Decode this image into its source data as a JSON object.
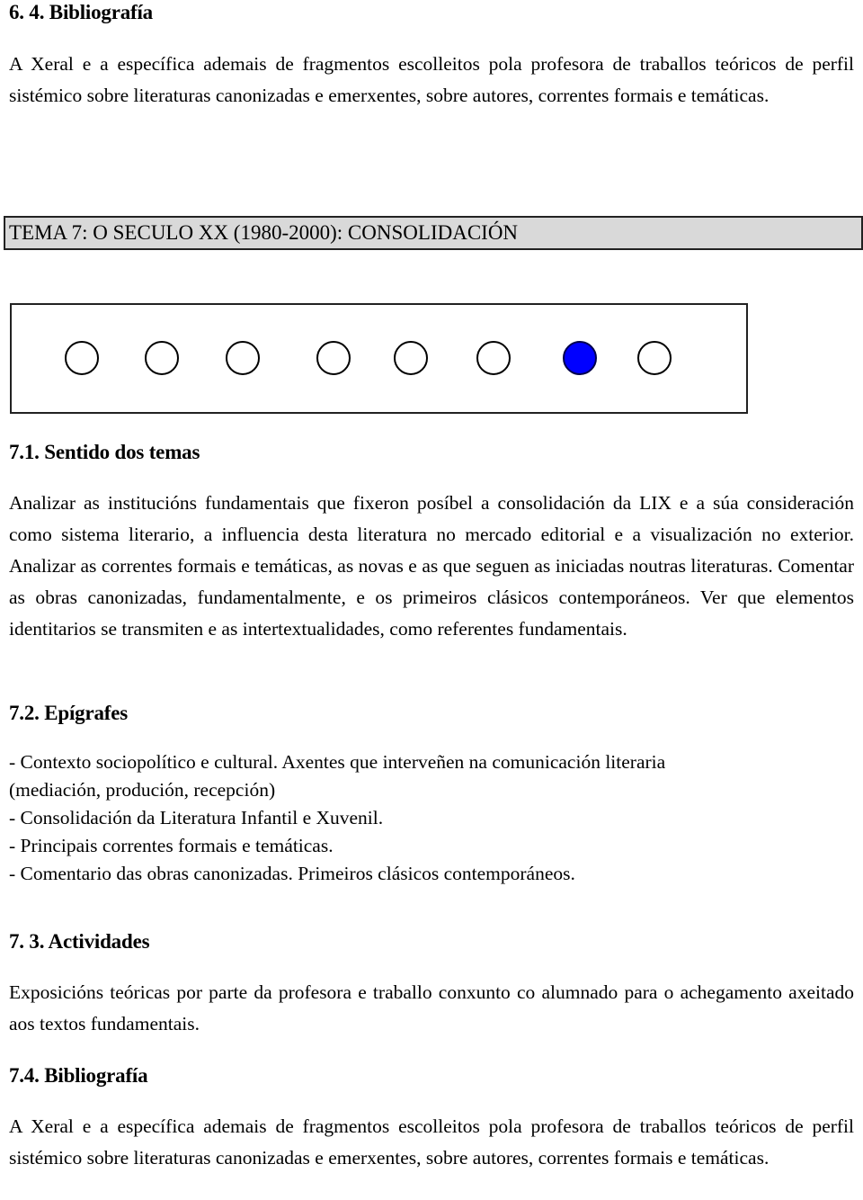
{
  "section_6_4": {
    "heading": "6. 4. Bibliografía",
    "body": "A Xeral e a específica ademais de fragmentos escolleitos pola profesora de traballos teóricos de perfil sistémico sobre literaturas canonizadas e emerxentes, sobre autores, correntes formais e temáticas."
  },
  "tema_banner": {
    "title": "TEMA 7: O SECULO XX (1980-2000): CONSOLIDACIÓN"
  },
  "progress": {
    "total_steps": 8,
    "current_step": 7,
    "active_color": "#0000ff",
    "steps": [
      "inactive",
      "inactive",
      "inactive",
      "inactive",
      "inactive",
      "inactive",
      "active",
      "inactive"
    ]
  },
  "section_7_1": {
    "heading": "7.1. Sentido dos temas",
    "body": "Analizar as institucións fundamentais que fixeron posíbel a consolidación da LIX e a súa consideración como sistema literario, a influencia desta literatura no mercado editorial e a visualización no exterior. Analizar as correntes formais e temáticas, as novas e as que seguen as iniciadas noutras literaturas. Comentar as obras canonizadas, fundamentalmente, e os primeiros clásicos contemporáneos. Ver que elementos identitarios se transmiten e as intertextualidades, como referentes fundamentais."
  },
  "section_7_2": {
    "heading": "7.2. Epígrafes",
    "lines": [
      "- Contexto sociopolítico e cultural. Axentes que interveñen na comunicación literaria",
      "(mediación, produción, recepción)",
      "- Consolidación da Literatura Infantil e Xuvenil.",
      "- Principais correntes formais e temáticas.",
      "- Comentario das obras canonizadas. Primeiros clásicos contemporáneos."
    ]
  },
  "section_7_3": {
    "heading": "7. 3. Actividades",
    "body": "Exposicións teóricas por parte da profesora e traballo conxunto co alumnado para o achegamento axeitado aos textos fundamentais."
  },
  "section_7_4": {
    "heading": "7.4. Bibliografía",
    "body": "A Xeral e a específica ademais de fragmentos escolleitos pola profesora de traballos teóricos de perfil sistémico sobre literaturas canonizadas e emerxentes, sobre autores, correntes formais e temáticas."
  }
}
